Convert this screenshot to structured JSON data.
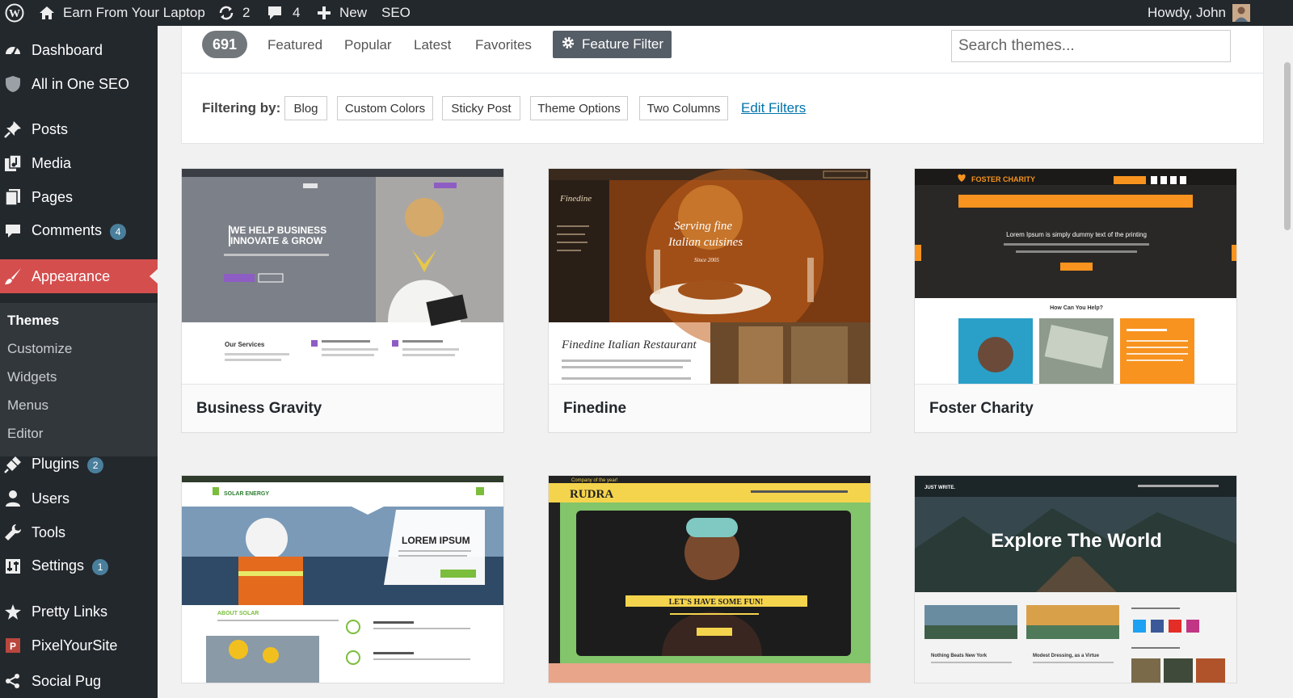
{
  "adminbar": {
    "site_name": "Earn From Your Laptop",
    "updates_count": "2",
    "comments_count": "4",
    "new_label": "New",
    "seo_label": "SEO",
    "greeting": "Howdy, John"
  },
  "sidebar": {
    "items": [
      {
        "label": "Dashboard",
        "icon": "dashboard-icon"
      },
      {
        "label": "All in One SEO",
        "icon": "shield-icon"
      },
      {
        "label": "Posts",
        "icon": "pin-icon"
      },
      {
        "label": "Media",
        "icon": "media-icon"
      },
      {
        "label": "Pages",
        "icon": "pages-icon"
      },
      {
        "label": "Comments",
        "icon": "comment-icon",
        "badge": "4"
      },
      {
        "label": "Appearance",
        "icon": "brush-icon"
      },
      {
        "label": "Plugins",
        "icon": "plug-icon",
        "badge": "2"
      },
      {
        "label": "Users",
        "icon": "user-icon"
      },
      {
        "label": "Tools",
        "icon": "wrench-icon"
      },
      {
        "label": "Settings",
        "icon": "settings-icon",
        "badge": "1"
      },
      {
        "label": "Pretty Links",
        "icon": "star-icon"
      },
      {
        "label": "PixelYourSite",
        "icon": "pixel-icon"
      },
      {
        "label": "Social Pug",
        "icon": "share-icon"
      }
    ],
    "submenu": [
      "Themes",
      "Customize",
      "Widgets",
      "Menus",
      "Editor"
    ]
  },
  "filter_bar": {
    "count": "691",
    "tabs": [
      "Featured",
      "Popular",
      "Latest",
      "Favorites"
    ],
    "feature_filter": "Feature Filter",
    "search_placeholder": "Search themes...",
    "filtering_label": "Filtering by:",
    "tags": [
      "Blog",
      "Custom Colors",
      "Sticky Post",
      "Theme Options",
      "Two Columns"
    ],
    "edit_filters": "Edit Filters"
  },
  "themes": [
    {
      "name": "Business Gravity",
      "headline": "WE HELP BUSINESS INNOVATE & GROW",
      "section": "Our Services"
    },
    {
      "name": "Finedine",
      "headline": "Serving fine Italian cuisines",
      "subline": "Since 2005",
      "title": "Finedine Italian Restaurant"
    },
    {
      "name": "Foster Charity",
      "logo": "FOSTER CHARITY",
      "headline": "Lorem Ipsum is simply dummy text of the printing",
      "section": "How Can You Help?"
    },
    {
      "name": "",
      "logo": "SOLAR ENERGY",
      "headline": "LOREM IPSUM",
      "section": "ABOUT SOLAR"
    },
    {
      "name": "",
      "logo": "RUDRA",
      "headline": "LET'S HAVE SOME FUN!",
      "tagline": "Company of the year!"
    },
    {
      "name": "",
      "logo": "JUST WRITE.",
      "headline": "Explore The World",
      "post1": "Nothing Beats New York",
      "post2": "Modest Dressing, as a Virtue"
    }
  ],
  "colors": {
    "adminbar": "#23282d",
    "active_menu": "#d54e4e",
    "badge": "#4a7f9c",
    "link": "#0073aa"
  }
}
